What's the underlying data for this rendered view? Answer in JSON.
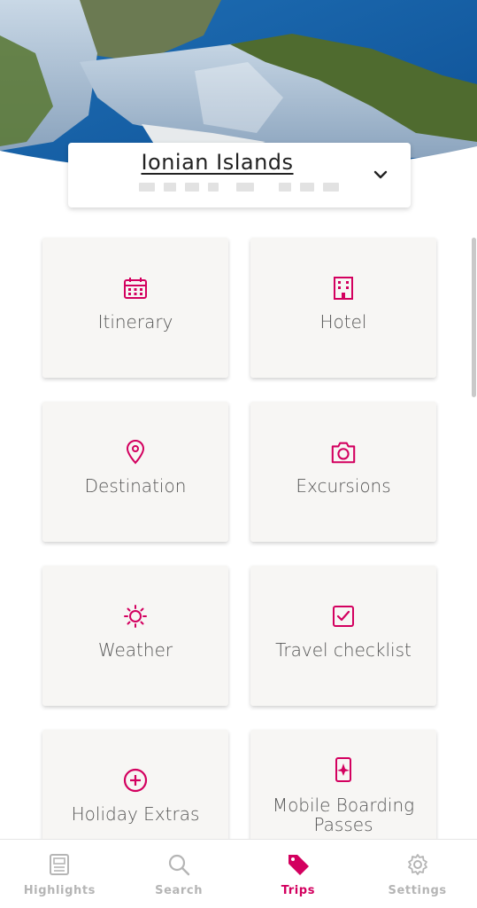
{
  "trip": {
    "title": "Ionian Islands"
  },
  "tiles": [
    {
      "label": "Itinerary",
      "icon": "calendar-icon"
    },
    {
      "label": "Hotel",
      "icon": "building-icon"
    },
    {
      "label": "Destination",
      "icon": "map-pin-icon"
    },
    {
      "label": "Excursions",
      "icon": "camera-icon"
    },
    {
      "label": "Weather",
      "icon": "sun-icon"
    },
    {
      "label": "Travel checklist",
      "icon": "checkbox-icon"
    },
    {
      "label": "Holiday Extras",
      "icon": "plus-circle-icon"
    },
    {
      "label": "Mobile Boarding Passes",
      "icon": "boarding-pass-icon"
    }
  ],
  "tabbar": {
    "items": [
      {
        "label": "Highlights",
        "icon": "highlights-icon",
        "active": false
      },
      {
        "label": "Search",
        "icon": "search-icon",
        "active": false
      },
      {
        "label": "Trips",
        "icon": "tag-icon",
        "active": true
      },
      {
        "label": "Settings",
        "icon": "gear-icon",
        "active": false
      }
    ]
  },
  "colors": {
    "accent": "#d3005f",
    "tile_bg": "#f7f6f4",
    "inactive_tab": "#b5b5b5"
  }
}
